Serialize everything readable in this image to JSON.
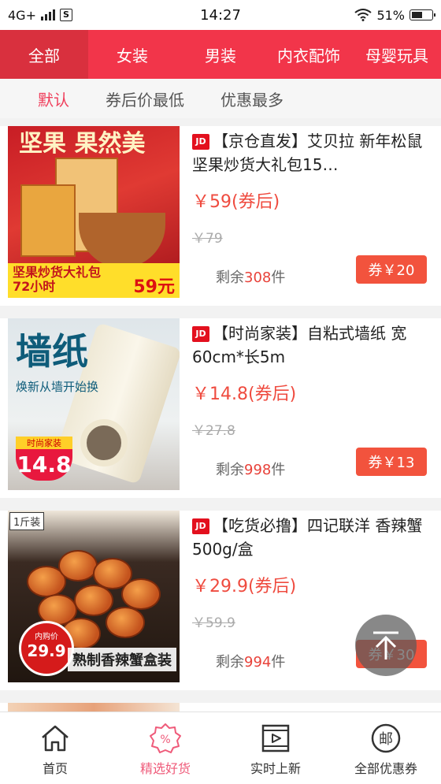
{
  "status_bar": {
    "network": "4G+",
    "app_badge": "S",
    "time": "14:27",
    "battery": "51%"
  },
  "categories": [
    "全部",
    "女装",
    "男装",
    "内衣配饰",
    "母婴玩具"
  ],
  "active_category": 0,
  "sort_options": [
    "默认",
    "券后价最低",
    "优惠最多"
  ],
  "active_sort": 0,
  "products": [
    {
      "platform": "JD",
      "title": "【京仓直发】艾贝拉 新年松鼠坚果炒货大礼包15…",
      "price": "￥59(券后)",
      "original_price": "￥79",
      "stock_label": "剩余",
      "stock_count": "308",
      "stock_unit": "件",
      "coupon": "券￥20",
      "thumb_text": {
        "headline": "坚果 果然美",
        "band": "坚果炒货大礼包",
        "band_sub": "72小时",
        "price": "59元"
      }
    },
    {
      "platform": "JD",
      "title": "【时尚家装】自粘式墙纸 宽60cm*长5m",
      "price": "￥14.8(券后)",
      "original_price": "￥27.8",
      "stock_label": "剩余",
      "stock_count": "998",
      "stock_unit": "件",
      "coupon": "券￥13",
      "thumb_text": {
        "headline": "墙纸",
        "sub": "焕新从墙开始换",
        "badge_title": "时尚家装",
        "badge_price": "14.8"
      }
    },
    {
      "platform": "JD",
      "title": "【吃货必撸】四记联洋 香辣蟹 500g/盒",
      "price": "￥29.9(券后)",
      "original_price": "￥59.9",
      "stock_label": "剩余",
      "stock_count": "994",
      "stock_unit": "件",
      "coupon": "券￥30",
      "thumb_text": {
        "tag": "1斤装",
        "label": "熟制香辣蟹盒装",
        "badge_title": "内购价",
        "badge_price": "29.9"
      }
    }
  ],
  "tabbar": [
    {
      "label": "首页",
      "icon": "home-icon"
    },
    {
      "label": "精选好货",
      "icon": "discount-icon"
    },
    {
      "label": "实时上新",
      "icon": "video-icon"
    },
    {
      "label": "全部优惠券",
      "icon": "coupon-icon"
    }
  ],
  "active_tab": 1,
  "colors": {
    "category_bar": "#f2354a",
    "accent": "#ef3e5b",
    "price": "#ef4b3f",
    "coupon_bg": "#f2533d"
  }
}
